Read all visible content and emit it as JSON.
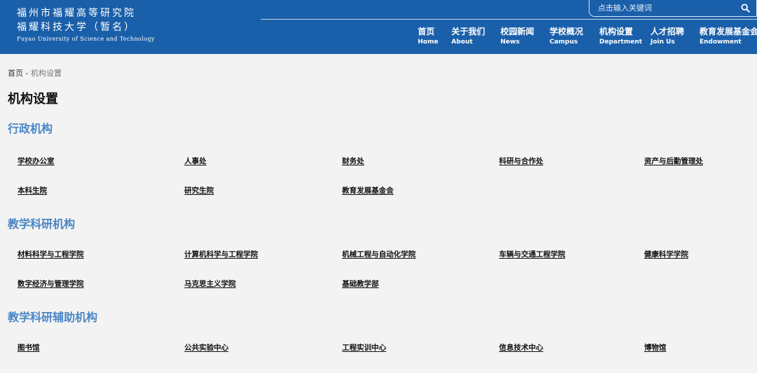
{
  "header": {
    "logo": {
      "line1": "福州市福耀高等研究院",
      "line2": "福耀科技大学（暂名）",
      "english": "Fuyao University of Science and Technology"
    },
    "search": {
      "placeholder": "点击输入关键词",
      "icon": "search-icon"
    },
    "nav": [
      {
        "cn": "首页",
        "en": "Home"
      },
      {
        "cn": "关于我们",
        "en": "About"
      },
      {
        "cn": "校园新闻",
        "en": "News"
      },
      {
        "cn": "学校概况",
        "en": "Campus"
      },
      {
        "cn": "机构设置",
        "en": "Department"
      },
      {
        "cn": "人才招聘",
        "en": "Join Us"
      },
      {
        "cn": "教育发展基金会",
        "en": "Endowment"
      }
    ],
    "color": "#1a5fa9"
  },
  "breadcrumb": {
    "home": "首页",
    "sep": " - ",
    "current": "机构设置"
  },
  "page_title": "机构设置",
  "sections": [
    {
      "title": "行政机构",
      "items": [
        "学校办公室",
        "人事处",
        "财务处",
        "科研与合作处",
        "资产与后勤管理处",
        "本科生院",
        "研究生院",
        "教育发展基金会"
      ]
    },
    {
      "title": "教学科研机构",
      "items": [
        "材料科学与工程学院",
        "计算机科学与工程学院",
        "机械工程与自动化学院",
        "车辆与交通工程学院",
        "健康科学学院",
        "数字经济与管理学院",
        "马克思主义学院",
        "基础教学部"
      ]
    },
    {
      "title": "教学科研辅助机构",
      "items": [
        "图书馆",
        "公共实验中心",
        "工程实训中心",
        "信息技术中心",
        "博物馆"
      ]
    }
  ],
  "accent_color": "#4a86c5"
}
